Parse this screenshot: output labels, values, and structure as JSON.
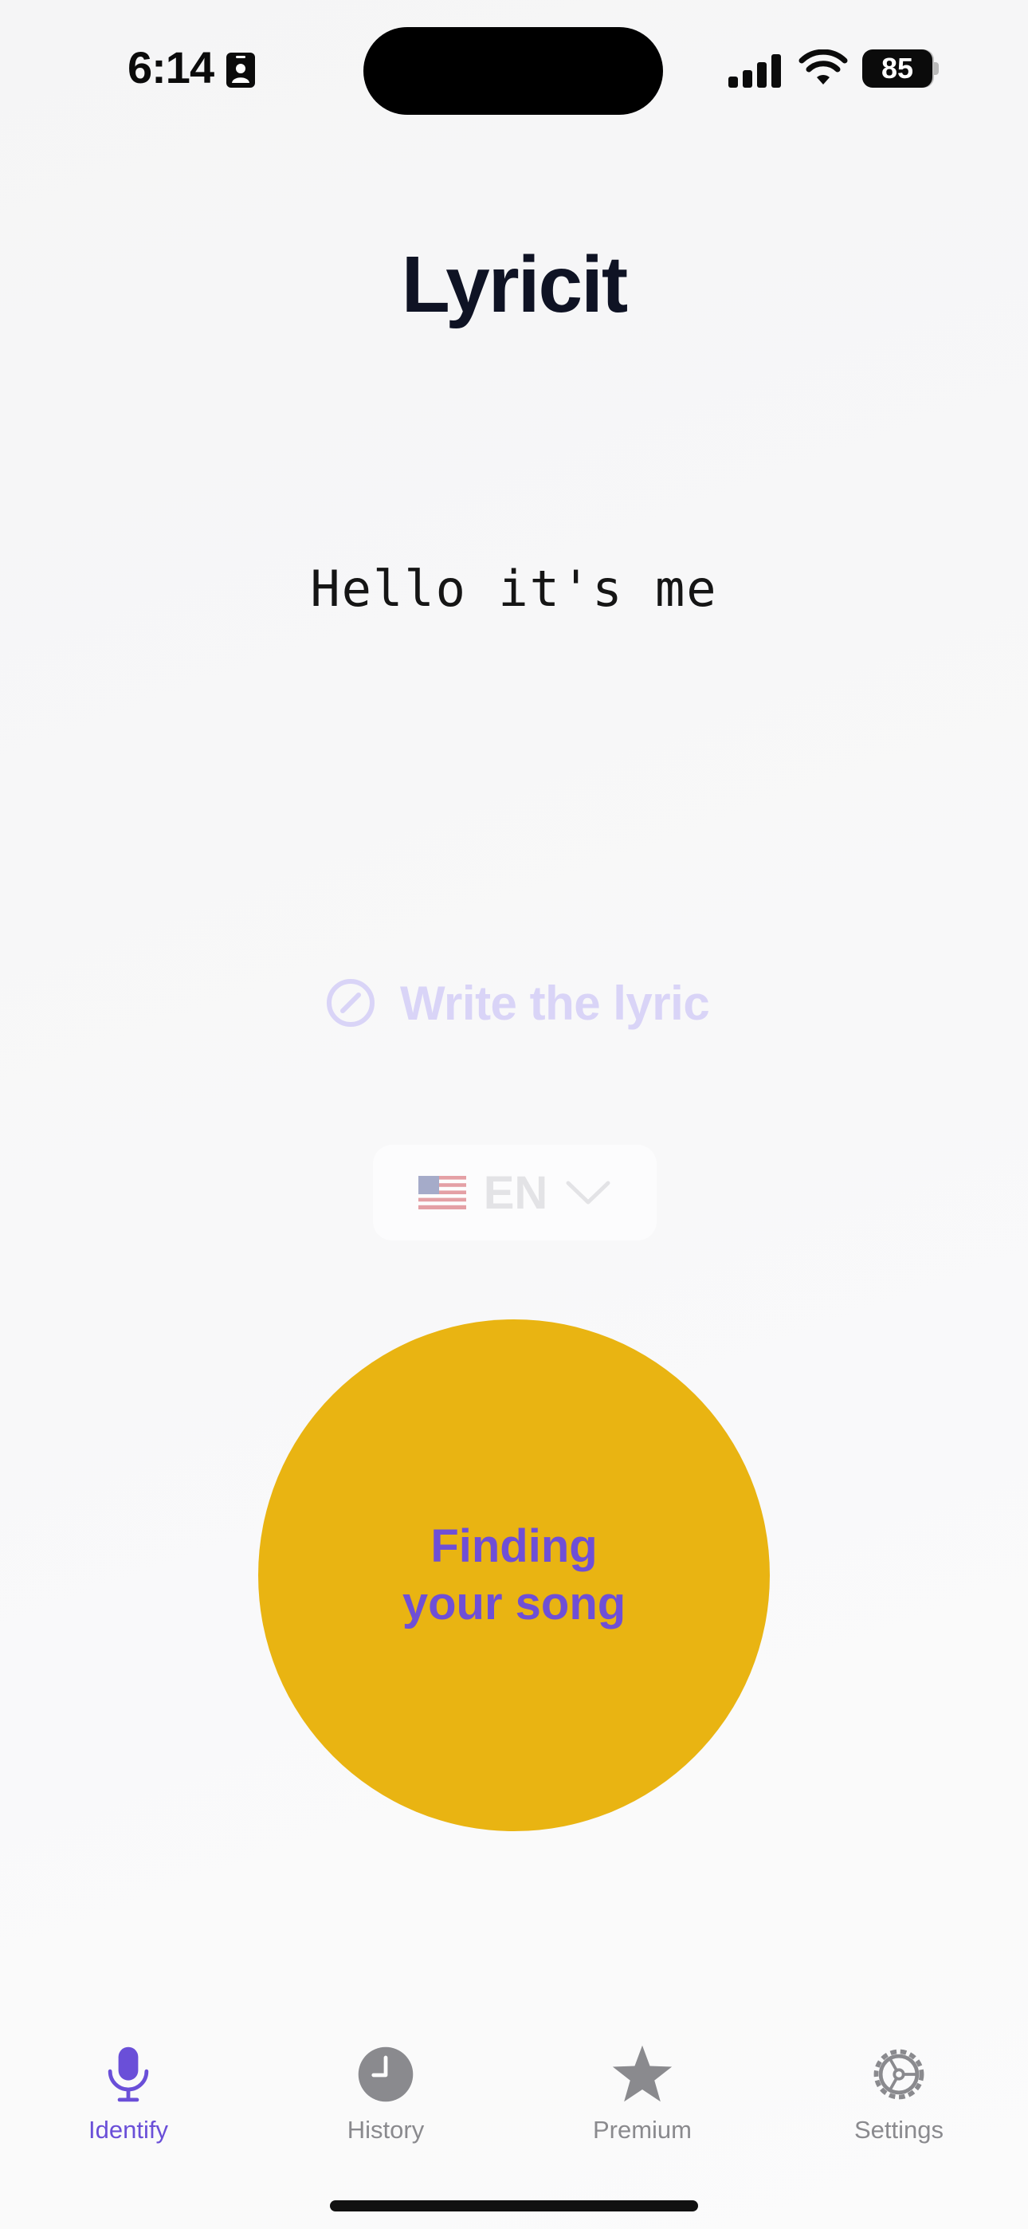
{
  "status_bar": {
    "time": "6:14",
    "battery": "85",
    "icons": [
      "contact-card-icon",
      "cellular-signal-icon",
      "wifi-icon",
      "battery-icon"
    ]
  },
  "header": {
    "title": "Lyricit"
  },
  "lyric": {
    "text": "Hello it's me"
  },
  "write_lyric": {
    "label": "Write the lyric",
    "icon": "edit-circle-icon"
  },
  "language": {
    "flag": "us-flag-icon",
    "code": "EN"
  },
  "record_button": {
    "line1": "Finding",
    "line2": "your song",
    "color": "#e9b412",
    "text_color": "#6f4fd6"
  },
  "tabs": [
    {
      "label": "Identify",
      "icon": "microphone-icon",
      "active": true
    },
    {
      "label": "History",
      "icon": "clock-icon",
      "active": false
    },
    {
      "label": "Premium",
      "icon": "star-icon",
      "active": false
    },
    {
      "label": "Settings",
      "icon": "gear-icon",
      "active": false
    }
  ],
  "colors": {
    "accent": "#6a4fd8",
    "inactive": "#8a8a8e"
  }
}
